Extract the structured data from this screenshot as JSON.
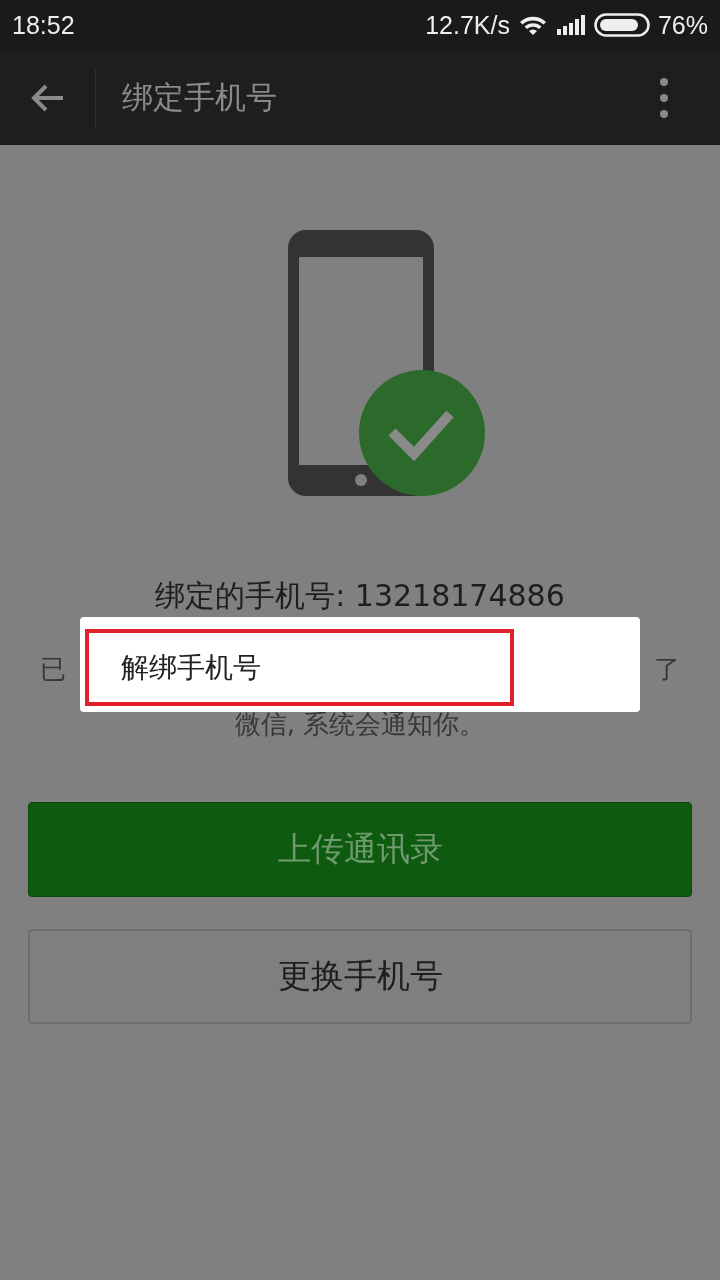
{
  "status_bar": {
    "time": "18:52",
    "net_speed": "12.7K/s",
    "battery": "76%"
  },
  "toolbar": {
    "title": "绑定手机号"
  },
  "bound_number": "绑定的手机号: 13218174886",
  "notice_fragments": [
    "已",
    "了"
  ],
  "notice_line_2": "微信, 系统会通知你。",
  "buttons": [
    {
      "label": "上传通讯录",
      "kind": "primary"
    },
    {
      "label": "更换手机号",
      "kind": "secondary"
    }
  ],
  "popup_menu": {
    "items": [
      {
        "label": "解绑手机号",
        "highlighted": true
      }
    ]
  }
}
